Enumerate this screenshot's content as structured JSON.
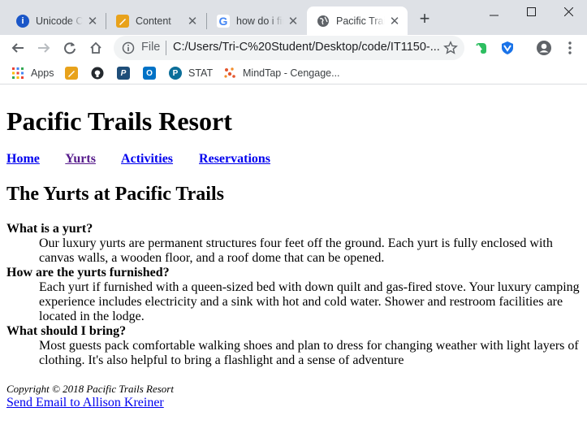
{
  "browser": {
    "tabs": [
      {
        "title": "Unicode Character",
        "icon": "info-icon",
        "color": "#1a56c8"
      },
      {
        "title": "Content",
        "icon": "pencil-notebook-icon",
        "color": "#e8a21b"
      },
      {
        "title": "how do i find",
        "icon": "google-icon",
        "color": "#4285f4"
      },
      {
        "title": "Pacific Trails Resort",
        "icon": "globe-icon",
        "color": "#5f6368"
      }
    ],
    "address": {
      "scheme": "File",
      "url": "C:/Users/Tri-C%20Student/Desktop/code/IT1150-..."
    },
    "bookmarks": [
      {
        "label": "Apps",
        "icon": "apps-grid-icon"
      },
      {
        "label": "",
        "icon": "pencil-notebook-icon"
      },
      {
        "label": "",
        "icon": "github-icon"
      },
      {
        "label": "",
        "icon": "p-logo-icon"
      },
      {
        "label": "",
        "icon": "outlook-icon"
      },
      {
        "label": "STAT",
        "icon": "pearson-icon"
      },
      {
        "label": "MindTap - Cengage...",
        "icon": "mindtap-icon"
      }
    ]
  },
  "page": {
    "title": "Pacific Trails Resort",
    "nav": [
      "Home",
      "Yurts",
      "Activities",
      "Reservations"
    ],
    "heading": "The Yurts at Pacific Trails",
    "faq": [
      {
        "q": "What is a yurt?",
        "a": "Our luxury yurts are permanent structures four feet off the ground. Each yurt is fully enclosed with canvas walls, a wooden floor, and a roof dome that can be opened."
      },
      {
        "q": "How are the yurts furnished?",
        "a": "Each yurt if furnished with a queen-sized bed with down quilt and gas-fired stove. Your luxury camping experience includes electricity and a sink with hot and cold water. Shower and restroom facilities are located in the lodge."
      },
      {
        "q": "What should I bring?",
        "a": "Most guests pack comfortable walking shoes and plan to dress for changing weather with light layers of clothing. It's also helpful to bring a flashlight and a sense of adventure"
      }
    ],
    "footer": {
      "copyright": "Copyright © 2018 Pacific Trails Resort",
      "email_link": "Send Email to Allison Kreiner"
    }
  }
}
